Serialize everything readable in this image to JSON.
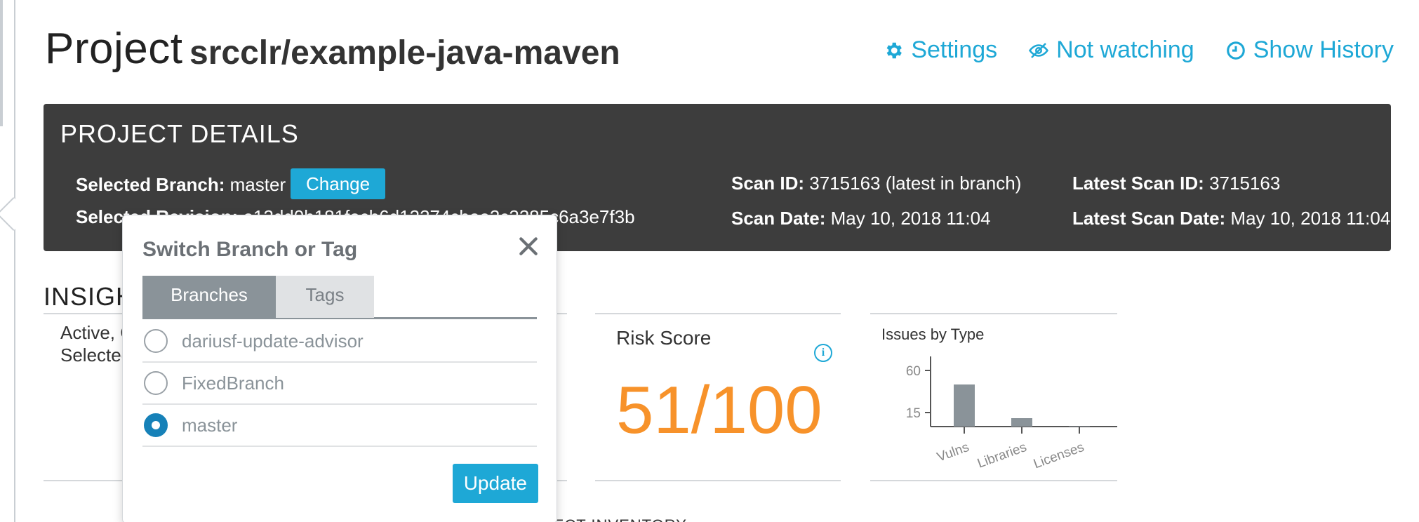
{
  "header": {
    "project_label": "Project",
    "project_name": "srcclr/example-java-maven",
    "links": [
      {
        "label": "Settings",
        "icon": "gear-icon"
      },
      {
        "label": "Not watching",
        "icon": "eye-slash-icon"
      },
      {
        "label": "Show History",
        "icon": "clock-icon"
      }
    ]
  },
  "details": {
    "title": "PROJECT DETAILS",
    "selected_branch_label": "Selected Branch:",
    "selected_branch_value": "master",
    "change_label": "Change",
    "selected_revision_label": "Selected Revision:",
    "selected_revision_value": "e12dd0b181fecb6d12274cbee2c2285c6a3e7f3b",
    "scan_id_label": "Scan ID:",
    "scan_id_value": "3715163 (latest in branch)",
    "scan_date_label": "Scan Date:",
    "scan_date_value": "May 10, 2018 11:04",
    "latest_scan_id_label": "Latest Scan ID:",
    "latest_scan_id_value": "3715163",
    "latest_scan_date_label": "Latest Scan Date:",
    "latest_scan_date_value": "May 10, 2018 11:04"
  },
  "insights": {
    "title": "INSIGHTS",
    "active_line1": "Active, C",
    "active_line2": "Selected",
    "risk_label": "Risk Score",
    "risk_value": "51/100",
    "issues_label": "Issues by Type",
    "inventory_label": "PROJECT INVENTORY"
  },
  "chart_data": {
    "type": "bar",
    "title": "Issues by Type",
    "categories": [
      "Vulns",
      "Libraries",
      "Licenses"
    ],
    "values": [
      45,
      9,
      0.5
    ],
    "yticks": [
      15,
      60
    ],
    "ylim": [
      0,
      75
    ],
    "grid": false,
    "bar_color": "#8a9399"
  },
  "popup": {
    "title": "Switch Branch or Tag",
    "tabs": [
      "Branches",
      "Tags"
    ],
    "active_tab": "Branches",
    "branches": [
      {
        "name": "dariusf-update-advisor",
        "selected": false
      },
      {
        "name": "FixedBranch",
        "selected": false
      },
      {
        "name": "master",
        "selected": true
      }
    ],
    "update_label": "Update"
  },
  "colors": {
    "accent": "#1ea8d6",
    "panel": "#3d3d3d",
    "risk": "#f7922a",
    "radio_selected": "#1681b8"
  }
}
